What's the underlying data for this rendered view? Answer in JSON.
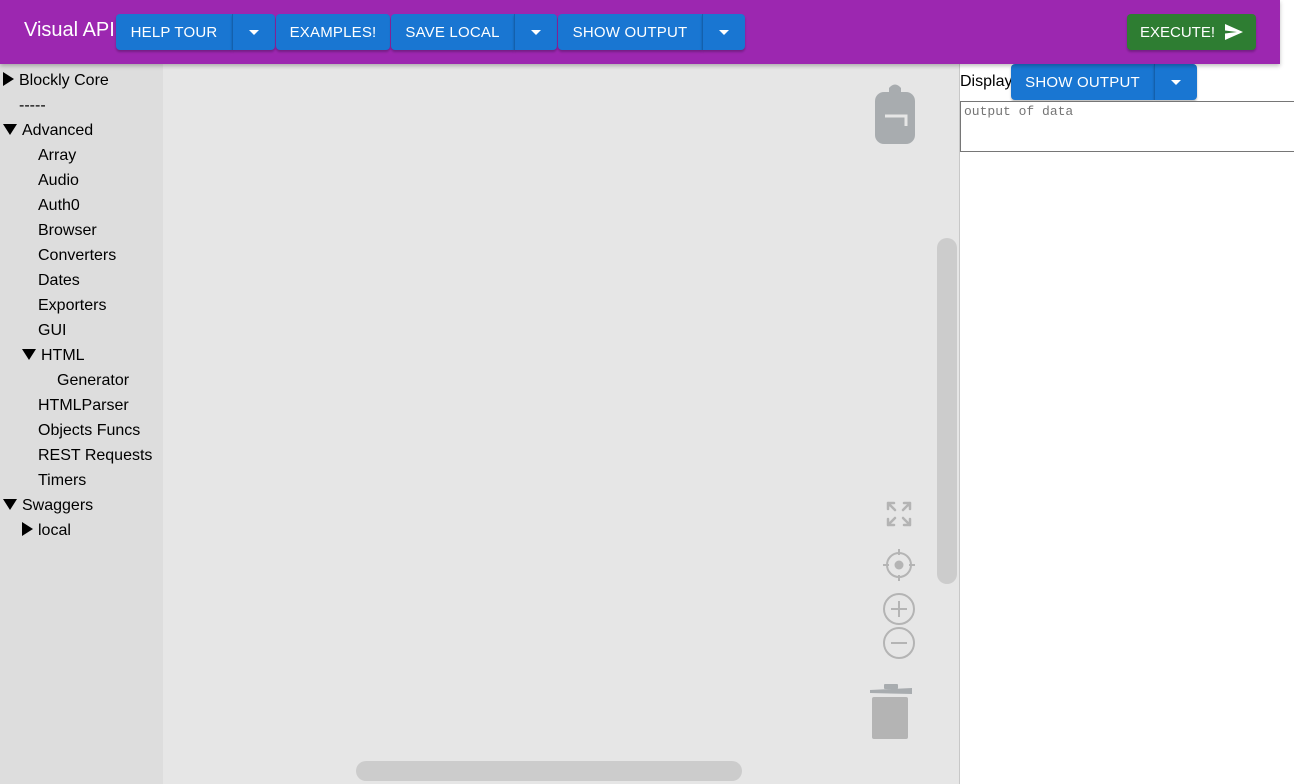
{
  "appbar": {
    "title": "Visual API",
    "help_tour_label": "HELP TOUR",
    "examples_label": "EXAMPLES!",
    "save_local_label": "SAVE LOCAL",
    "show_output_label": "SHOW OUTPUT",
    "execute_label": "EXECUTE!"
  },
  "tree": {
    "items": [
      {
        "label": "Blockly Core",
        "state": "collapsed"
      },
      {
        "label": "-----"
      },
      {
        "label": "Advanced",
        "state": "expanded"
      },
      {
        "label": "Array"
      },
      {
        "label": "Audio"
      },
      {
        "label": "Auth0"
      },
      {
        "label": "Browser"
      },
      {
        "label": "Converters"
      },
      {
        "label": "Dates"
      },
      {
        "label": "Exporters"
      },
      {
        "label": "GUI"
      },
      {
        "label": "HTML",
        "state": "expanded"
      },
      {
        "label": "Generator"
      },
      {
        "label": "HTMLParser"
      },
      {
        "label": "Objects Funcs"
      },
      {
        "label": "REST Requests"
      },
      {
        "label": "Timers"
      },
      {
        "label": "Swaggers",
        "state": "expanded"
      },
      {
        "label": "local",
        "state": "collapsed"
      }
    ]
  },
  "workspace": {
    "icons": [
      "backpack-icon",
      "fullscreen-icon",
      "recenter-icon",
      "zoom-in-icon",
      "zoom-out-icon",
      "trash-icon"
    ]
  },
  "right_panel": {
    "display_label": "Display",
    "show_output_label": "SHOW OUTPUT",
    "output_placeholder": "output of data"
  },
  "colors": {
    "appbar": "#9c27b0",
    "primary_button": "#1976d2",
    "execute_button": "#2e7d32",
    "tree_background": "#dddddd",
    "workspace_background": "#e6e6e6"
  }
}
